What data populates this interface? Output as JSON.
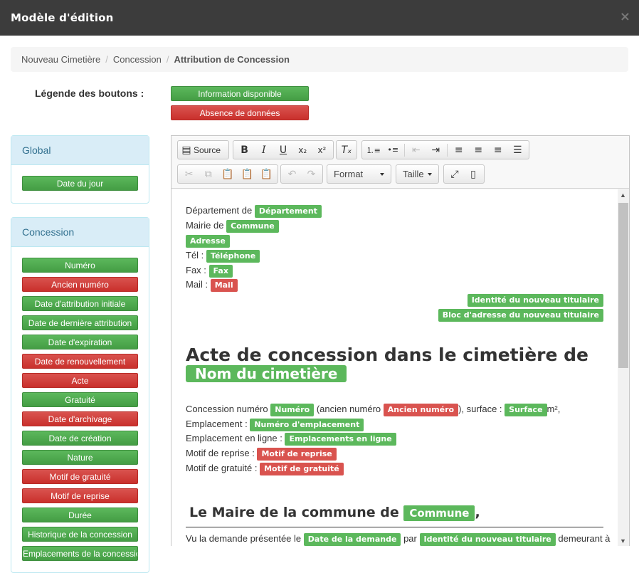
{
  "window": {
    "title": "Modèle d'édition",
    "close_glyph": "×"
  },
  "breadcrumb": [
    "Nouveau Cimetière",
    "Concession",
    "Attribution de Concession"
  ],
  "legend": {
    "label": "Légende des boutons :",
    "available": "Information disponible",
    "missing": "Absence de données"
  },
  "panels": {
    "global": {
      "title": "Global",
      "buttons": [
        {
          "label": "Date du jour",
          "state": "green"
        }
      ]
    },
    "concession": {
      "title": "Concession",
      "buttons": [
        {
          "label": "Numéro",
          "state": "green"
        },
        {
          "label": "Ancien numéro",
          "state": "red"
        },
        {
          "label": "Date d'attribution initiale",
          "state": "green"
        },
        {
          "label": "Date de dernière attribution",
          "state": "green"
        },
        {
          "label": "Date d'expiration",
          "state": "green"
        },
        {
          "label": "Date de renouvellement",
          "state": "red"
        },
        {
          "label": "Acte",
          "state": "red"
        },
        {
          "label": "Gratuité",
          "state": "green"
        },
        {
          "label": "Date d'archivage",
          "state": "red"
        },
        {
          "label": "Date de création",
          "state": "green"
        },
        {
          "label": "Nature",
          "state": "green"
        },
        {
          "label": "Motif de gratuité",
          "state": "red"
        },
        {
          "label": "Motif de reprise",
          "state": "red"
        },
        {
          "label": "Durée",
          "state": "green"
        },
        {
          "label": "Historique de la concession",
          "state": "green"
        },
        {
          "label": "Emplacements de la concession",
          "state": "green"
        }
      ]
    }
  },
  "toolbar": {
    "source_label": "Source",
    "format_label": "Format",
    "size_label": "Taille"
  },
  "document": {
    "dept_label": "Département de",
    "dept_tag": "Département",
    "mairie_label": "Mairie de",
    "mairie_tag": "Commune",
    "adresse_tag": "Adresse",
    "tel_label": "Tél :",
    "tel_tag": "Téléphone",
    "fax_label": "Fax :",
    "fax_tag": "Fax",
    "mail_label": "Mail :",
    "mail_tag": "Mail",
    "titulaire_tag": "Identité du nouveau titulaire",
    "adresse_titulaire_tag": "Bloc d'adresse du nouveau titulaire",
    "heading": "Acte de concession dans le cimetière de",
    "heading_tag": "Nom du cimetière",
    "l1_a": "Concession numéro",
    "l1_tag1": "Numéro",
    "l1_b": "(ancien numéro",
    "l1_tag2": "Ancien numéro",
    "l1_c": "), surface :",
    "l1_tag3": "Surface",
    "l1_d": "m²,",
    "l2_a": "Emplacement :",
    "l2_tag": "Numéro d'emplacement",
    "l3_a": "Emplacement en ligne :",
    "l3_tag": "Emplacements en ligne",
    "l4_a": "Motif de reprise :",
    "l4_tag": "Motif de reprise",
    "l5_a": "Motif de gratuité :",
    "l5_tag": "Motif de gratuité",
    "h2": "Le Maire de la commune de",
    "h2_tag": "Commune",
    "h2_end": ",",
    "last_a": "Vu la demande présentée le",
    "last_tag1": "Date de la demande",
    "last_b": "par",
    "last_tag2": "Identité du nouveau titulaire",
    "last_c": "demeurant à"
  }
}
